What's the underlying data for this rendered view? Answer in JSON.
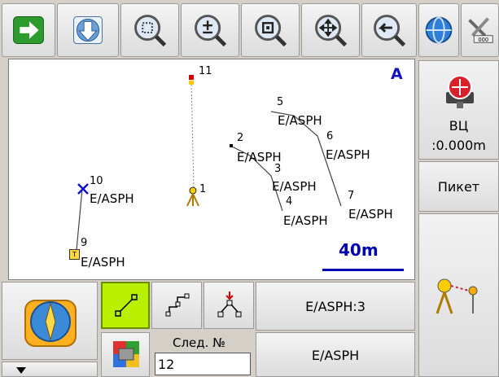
{
  "toolbar": {
    "buttons": [
      {
        "name": "forward-arrow"
      },
      {
        "name": "download"
      },
      {
        "name": "zoom-fit"
      },
      {
        "name": "zoom-plus-minus"
      },
      {
        "name": "zoom-window"
      },
      {
        "name": "pan"
      },
      {
        "name": "zoom-previous"
      },
      {
        "name": "globe"
      },
      {
        "name": "tools"
      }
    ]
  },
  "map": {
    "north_label": "A",
    "scale_label": "40m",
    "points": [
      {
        "id": "11",
        "code": ""
      },
      {
        "id": "1",
        "code": ""
      },
      {
        "id": "5",
        "code": "E/ASPH"
      },
      {
        "id": "2",
        "code": "E/ASPH"
      },
      {
        "id": "6",
        "code": "E/ASPH"
      },
      {
        "id": "3",
        "code": "E/ASPH"
      },
      {
        "id": "4",
        "code": "E/ASPH"
      },
      {
        "id": "7",
        "code": "E/ASPH"
      },
      {
        "id": "10",
        "code": "E/ASPH"
      },
      {
        "id": "9",
        "code": "E/ASPH"
      }
    ]
  },
  "side": {
    "target_height_label": "ВЦ",
    "target_height_value": ":0.000m",
    "picket_label": "Пикет"
  },
  "bottom": {
    "code_button_top": "E/ASPH:3",
    "code_button_bottom": "E/ASPH",
    "next_no_label": "След. №",
    "next_no_value": "12"
  },
  "colors": {
    "accent": "#0000c0",
    "line_green": "#b8f000"
  }
}
